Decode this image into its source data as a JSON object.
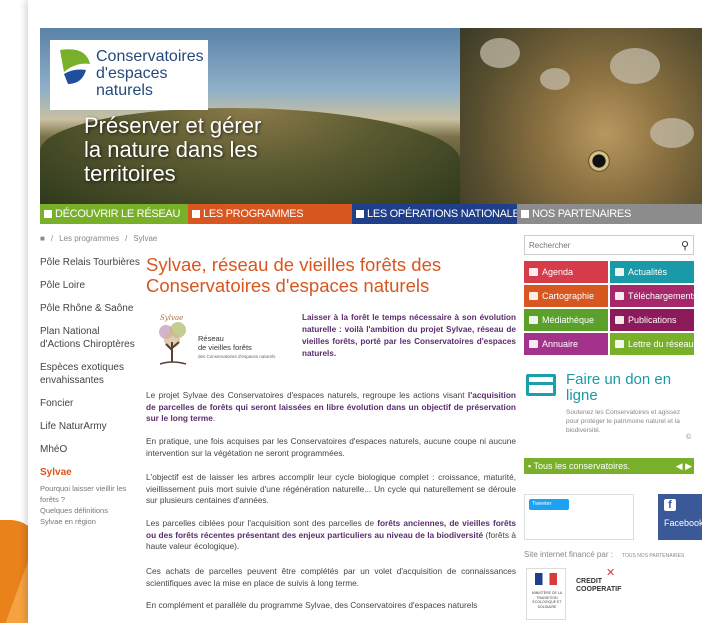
{
  "banner": {
    "logo_text": [
      "Conservatoires",
      "d'espaces",
      "naturels"
    ],
    "slogan": "Préserver et gérer la nature dans les territoires"
  },
  "nav": {
    "items": [
      {
        "label": "DÉCOUVRIR LE RÉSEAU",
        "color": "#78b02a"
      },
      {
        "label": "LES PROGRAMMES",
        "color": "#d8561f"
      },
      {
        "label": "LES OPÉRATIONS NATIONALES",
        "color": "#1f3f8a"
      },
      {
        "label": "NOS PARTENAIRES",
        "color": "#8c8c8c"
      }
    ]
  },
  "breadcrumb": {
    "home_icon": "home-icon",
    "items": [
      "Les programmes",
      "Sylvae"
    ],
    "separator": "/"
  },
  "leftnav": {
    "items": [
      "Pôle Relais Tourbières",
      "Pôle Loire",
      "Pôle Rhône & Saône",
      "Plan National d'Actions Chiroptères",
      "Espèces exotiques envahissantes",
      "Foncier",
      "Life NaturArmy",
      "MhéO",
      "Sylvae"
    ],
    "active": "Sylvae",
    "sub_items": [
      "Pourquoi laisser vieillir les forêts ?",
      "Quelques définitions",
      "Sylvae en région"
    ]
  },
  "main": {
    "title": "Sylvae, réseau de vieilles forêts des Conservatoires d'espaces naturels",
    "sylvae_logo": {
      "word": "Sylvae",
      "line1": "Réseau",
      "line2": "de vieilles forêts",
      "line3": "des Conservatoires d'espaces naturels"
    },
    "intro": "Laisser à la forêt le temps nécessaire à son évolution naturelle : voilà l'ambition du projet Sylvae, réseau de vieilles forêts, porté par les Conservatoires d'espaces naturels.",
    "p1_a": "Le projet Sylvae des Conservatoires d'espaces naturels, regroupe les actions visant",
    "p1_b": "l'acquisition de parcelles de forêts qui seront laissées en libre évolution dans un objectif de préservation sur le long terme",
    "p1_c": ".",
    "p2": "En pratique, une fois acquises par les Conservatoires d'espaces naturels, aucune coupe ni aucune intervention sur la végétation ne seront programmées.",
    "p3": "L'objectif est de laisser les arbres accomplir leur cycle biologique complet : croissance, maturité, vieillissement puis mort suivie d'une régénération naturelle... Un cycle qui naturellement se déroule sur plusieurs centaines d'années.",
    "p4_a": "Les parcelles ciblées pour l'acquisition sont des parcelles de",
    "p4_b": "forêts anciennes, de vieilles forêts ou des forêts récentes présentant des enjeux particuliers au niveau de la biodiversité",
    "p4_c": "(forêts à haute valeur écologique).",
    "p5": "Ces achats de parcelles peuvent être complétés par un volet d'acquisition de connaissances scientifiques avec la mise en place de suivis à long terme.",
    "p6": "En complément et parallèle du programme Sylvae, des Conservatoires d'espaces naturels"
  },
  "sidebar": {
    "search_placeholder": "Rechercher",
    "quick_links": [
      {
        "label": "Agenda",
        "icon": "calendar-icon"
      },
      {
        "label": "Actualités",
        "icon": "megaphone-icon"
      },
      {
        "label": "Cartographie",
        "icon": "map-pin-icon"
      },
      {
        "label": "Téléchargements",
        "icon": "download-icon"
      },
      {
        "label": "Médiathèque",
        "icon": "image-icon"
      },
      {
        "label": "Publications",
        "icon": "book-icon"
      },
      {
        "label": "Annuaire",
        "icon": "user-icon"
      },
      {
        "label": "Lettre du réseau",
        "icon": "document-icon"
      }
    ],
    "don_title": "Faire un don en ligne",
    "don_text": "Soutenez les Conservatoires et agissez pour protéger le patrimoine naturel et la biodiversité.",
    "copyright": "©",
    "tous": "Tous les conservatoires.",
    "twitter_label": "Tweeter",
    "facebook_label": "Facebook",
    "finance_label": "Site internet financé par :",
    "finance_link": "TOUS NOS PARTENAIRES",
    "ministere_text": "MINISTÈRE DE LA TRANSITION ÉCOLOGIQUE ET SOLIDAIRE",
    "credit_coop": [
      "CREDIT",
      "COOPERATIF"
    ]
  }
}
